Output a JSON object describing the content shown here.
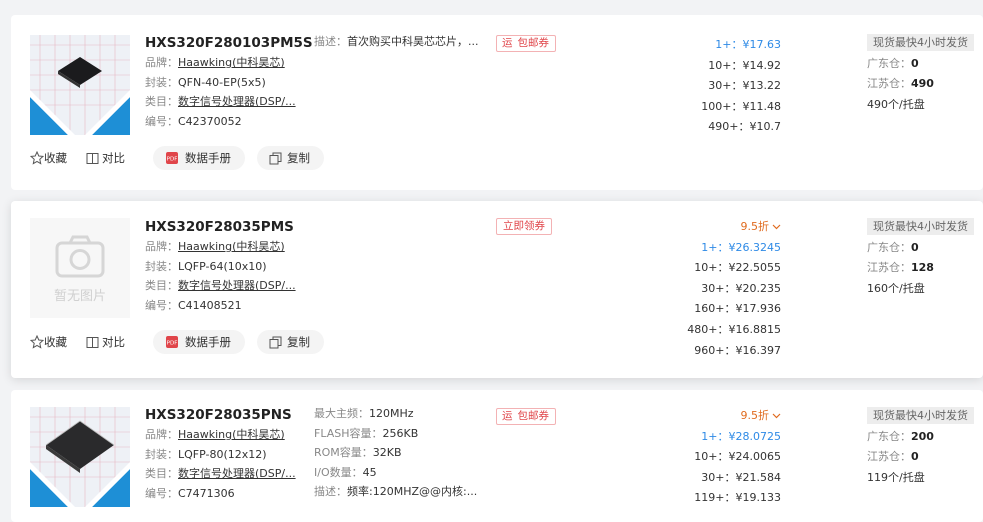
{
  "labels": {
    "brand": "品牌：",
    "package": "封装：",
    "category": "类目：",
    "code": "编号：",
    "desc": "描述：",
    "fav": "收藏",
    "compare": "对比",
    "datasheet": "数据手册",
    "copy": "复制",
    "guangdong": "广东仓：",
    "jiangsu": "江苏仓：",
    "stock_header": "现货最快4小时发货",
    "no_image": "暂无图片",
    "freight_tag": "运"
  },
  "products": [
    {
      "title": "HXS320F280103PM5S",
      "brand": "Haawking(中科昊芯)",
      "package": "QFN-40-EP(5x5)",
      "category": "数字信号处理器(DSP/...",
      "code": "C42370052",
      "specs": [
        {
          "label": "描述：",
          "value": "首次购买中科昊芯芯片，..."
        }
      ],
      "badge": "包邮券",
      "discount": "",
      "prices": [
        {
          "qty": "1+：",
          "price": "¥17.63"
        },
        {
          "qty": "10+：",
          "price": "¥14.92"
        },
        {
          "qty": "30+：",
          "price": "¥13.22"
        },
        {
          "qty": "100+：",
          "price": "¥11.48"
        },
        {
          "qty": "490+：",
          "price": "¥10.7"
        }
      ],
      "guangdong": "0",
      "jiangsu": "490",
      "unit": "490个/托盘"
    },
    {
      "title": "HXS320F28035PMS",
      "brand": "Haawking(中科昊芯)",
      "package": "LQFP-64(10x10)",
      "category": "数字信号处理器(DSP/...",
      "code": "C41408521",
      "specs": [],
      "badge": "立即领券",
      "discount": "9.5折",
      "prices": [
        {
          "qty": "1+：",
          "price": "¥26.3245"
        },
        {
          "qty": "10+：",
          "price": "¥22.5055"
        },
        {
          "qty": "30+：",
          "price": "¥20.235"
        },
        {
          "qty": "160+：",
          "price": "¥17.936"
        },
        {
          "qty": "480+：",
          "price": "¥16.8815"
        },
        {
          "qty": "960+：",
          "price": "¥16.397"
        }
      ],
      "guangdong": "0",
      "jiangsu": "128",
      "unit": "160个/托盘"
    },
    {
      "title": "HXS320F28035PNS",
      "brand": "Haawking(中科昊芯)",
      "package": "LQFP-80(12x12)",
      "category": "数字信号处理器(DSP/...",
      "code": "C7471306",
      "specs": [
        {
          "label": "最大主频：",
          "value": "120MHz"
        },
        {
          "label": "FLASH容量：",
          "value": "256KB"
        },
        {
          "label": "ROM容量：",
          "value": "32KB"
        },
        {
          "label": "I/O数量：",
          "value": "45"
        },
        {
          "label": "描述：",
          "value": "频率:120MHZ@@内核:..."
        }
      ],
      "badge": "包邮券",
      "discount": "9.5折",
      "prices": [
        {
          "qty": "1+：",
          "price": "¥28.0725"
        },
        {
          "qty": "10+：",
          "price": "¥24.0065"
        },
        {
          "qty": "30+：",
          "price": "¥21.584"
        },
        {
          "qty": "119+：",
          "price": "¥19.133"
        }
      ],
      "guangdong": "200",
      "jiangsu": "0",
      "unit": "119个/托盘"
    }
  ],
  "colors": {
    "price_lead": "#2e8ae6",
    "discount": "#e06b1f",
    "badge": "#e0454a"
  }
}
